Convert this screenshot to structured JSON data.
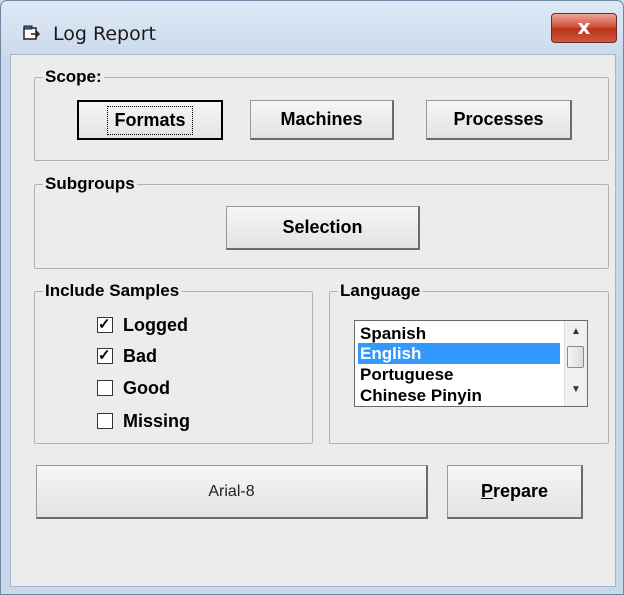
{
  "window": {
    "title": "Log Report",
    "close_label": "x"
  },
  "scope": {
    "legend": "Scope:",
    "buttons": [
      "Formats",
      "Machines",
      "Processes"
    ]
  },
  "subgroups": {
    "legend": "Subgroups",
    "selection_label": "Selection"
  },
  "include_samples": {
    "legend": "Include Samples",
    "items": [
      {
        "label": "Logged",
        "checked": true
      },
      {
        "label": "Bad",
        "checked": true
      },
      {
        "label": "Good",
        "checked": false
      },
      {
        "label": "Missing",
        "checked": false
      }
    ]
  },
  "language": {
    "legend": "Language",
    "options": [
      "Spanish",
      "English",
      "Portuguese",
      "Chinese Pinyin"
    ],
    "selected": "English"
  },
  "footer": {
    "font_button": "Arial-8",
    "prepare_first": "P",
    "prepare_rest": "repare"
  },
  "colors": {
    "selection": "#3399ff",
    "close": "#c7452e"
  },
  "icons": {
    "title": "log-report-icon",
    "close": "close-icon"
  }
}
